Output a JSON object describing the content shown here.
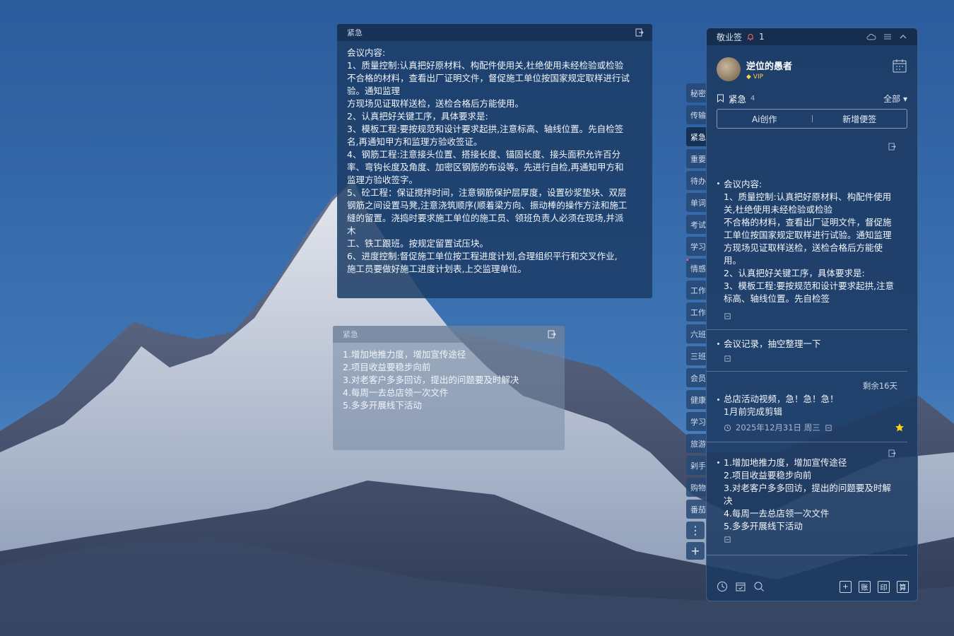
{
  "note1": {
    "header": "紧急",
    "lines": [
      "会议内容:",
      "1、质量控制:认真把好原材料、构配件使用关,杜绝使用未经检验或检验",
      "不合格的材料，查看出厂证明文件，督促施工单位按国家规定取样进行试",
      "验。通知监理",
      "方现场见证取样送检，送检合格后方能使用。",
      "2、认真把好关键工序，具体要求是:",
      "3、模板工程:要按规范和设计要求起拱,注意标高、轴线位置。先自检签",
      "名,再通知甲方和监理方验收签证。",
      "4、钢筋工程:注意接头位置、搭接长度、锚固长度、接头面积允许百分",
      "率、弯钩长度及角度、加密区钢筋的布设等。先进行自检,再通知甲方和",
      "监理方验收签字。",
      "5、砼工程：保证搅拌时间，注意钢筋保护层厚度，设置砂浆垫块、双层",
      "钢筋之间设置马凳,注意浇筑顺序(顺着梁方向、振动棒的操作方法和施工",
      "缝的留置。浇捣时要求施工单位的施工员、领班负责人必须在现场,并派",
      "木",
      "工、铁工跟班。按规定留置试压块。",
      "6、进度控制:督促施工单位按工程进度计划,合理组织平行和交叉作业,",
      "施工员要做好施工进度计划表,上交监理单位。"
    ]
  },
  "note2": {
    "header": "紧急",
    "lines": [
      "1.增加地推力度，增加宣传途径",
      "2.项目收益要稳步向前",
      "3.对老客户多多回访，提出的问题要及时解决",
      "4.每周一去总店领一次文件",
      "5.多多开展线下活动"
    ]
  },
  "tabs": [
    "秘密",
    "传输",
    "紧急",
    "重要",
    "待办",
    "单词",
    "考试",
    "学习",
    "情感",
    "工作",
    "工作",
    "六班",
    "三班",
    "会员",
    "健康",
    "学习",
    "旅游",
    "剁手",
    "购物",
    "番茄"
  ],
  "tab_tools": {
    "more": "⋮",
    "add": "+"
  },
  "panel": {
    "app_name": "敬业签",
    "reminder_count": "1",
    "user": {
      "name": "逆位的愚者",
      "vip": "VIP"
    },
    "group": {
      "name": "紧急",
      "count": "4",
      "filter": "全部"
    },
    "actions": {
      "ai": "Ai创作",
      "add": "新增便签"
    },
    "items": [
      {
        "lines": [
          "会议内容:",
          "1、质量控制:认真把好原材料、构配件使用",
          "关,杜绝使用未经检验或检验",
          "不合格的材料，查看出厂证明文件，督促施",
          "工单位按国家规定取样进行试验。通知监理",
          "方现场见证取样送检，送检合格后方能使",
          "用。",
          "2、认真把好关键工序，具体要求是:",
          "3、模板工程:要按规范和设计要求起拱,注意",
          "标高、轴线位置。先自检签"
        ]
      },
      {
        "lines": [
          "会议记录，抽空整理一下"
        ]
      },
      {
        "remaining": "剩余16天",
        "lines": [
          "总店活动视频，急！急！急！",
          "1月前完成剪辑"
        ],
        "date": "2025年12月31日 周三"
      },
      {
        "lines": [
          "1.增加地推力度，增加宣传途径",
          "2.项目收益要稳步向前",
          "3.对老客户多多回访，提出的问题要及时解",
          "决",
          "4.每周一去总店领一次文件",
          "5.多多开展线下活动"
        ]
      }
    ],
    "bottom_buttons": {
      "account": "账",
      "print": "印",
      "calc": "算"
    }
  },
  "colors": {
    "accent_star": "#ffd21e",
    "panel_bg": "#1c3a62"
  }
}
